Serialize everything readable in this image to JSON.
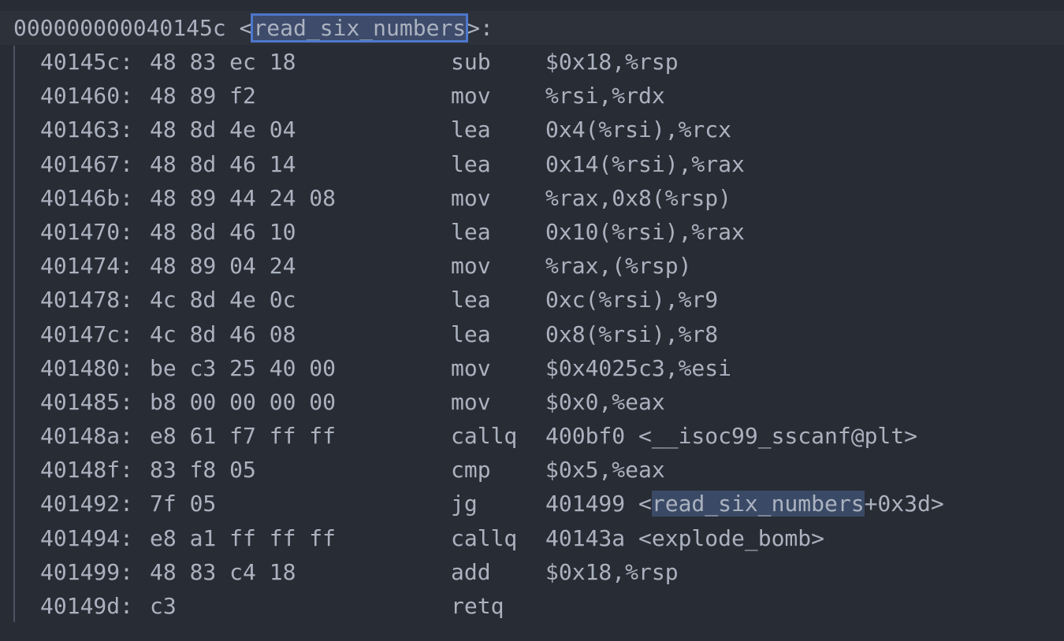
{
  "header": {
    "address": "000000000040145c",
    "open": " <",
    "function_name": "read_six_numbers",
    "close": ">:"
  },
  "highlight_colors": {
    "selection": "#3e4b6b",
    "selection_border": "#4d78cc",
    "line_highlight": "#2c313a",
    "background": "#282c34",
    "text": "#abb2bf"
  },
  "instructions": [
    {
      "addr": "40145c:",
      "bytes": "48 83 ec 18",
      "mnem": "sub",
      "ops": "$0x18,%rsp"
    },
    {
      "addr": "401460:",
      "bytes": "48 89 f2",
      "mnem": "mov",
      "ops": "%rsi,%rdx"
    },
    {
      "addr": "401463:",
      "bytes": "48 8d 4e 04",
      "mnem": "lea",
      "ops": "0x4(%rsi),%rcx"
    },
    {
      "addr": "401467:",
      "bytes": "48 8d 46 14",
      "mnem": "lea",
      "ops": "0x14(%rsi),%rax"
    },
    {
      "addr": "40146b:",
      "bytes": "48 89 44 24 08",
      "mnem": "mov",
      "ops": "%rax,0x8(%rsp)"
    },
    {
      "addr": "401470:",
      "bytes": "48 8d 46 10",
      "mnem": "lea",
      "ops": "0x10(%rsi),%rax"
    },
    {
      "addr": "401474:",
      "bytes": "48 89 04 24",
      "mnem": "mov",
      "ops": "%rax,(%rsp)"
    },
    {
      "addr": "401478:",
      "bytes": "4c 8d 4e 0c",
      "mnem": "lea",
      "ops": "0xc(%rsi),%r9"
    },
    {
      "addr": "40147c:",
      "bytes": "4c 8d 46 08",
      "mnem": "lea",
      "ops": "0x8(%rsi),%r8"
    },
    {
      "addr": "401480:",
      "bytes": "be c3 25 40 00",
      "mnem": "mov",
      "ops": "$0x4025c3,%esi"
    },
    {
      "addr": "401485:",
      "bytes": "b8 00 00 00 00",
      "mnem": "mov",
      "ops": "$0x0,%eax"
    },
    {
      "addr": "40148a:",
      "bytes": "e8 61 f7 ff ff",
      "mnem": "callq",
      "ops": "400bf0 <__isoc99_sscanf@plt>"
    },
    {
      "addr": "40148f:",
      "bytes": "83 f8 05",
      "mnem": "cmp",
      "ops": "$0x5,%eax"
    },
    {
      "addr": "401492:",
      "bytes": "7f 05",
      "mnem": "jg",
      "ops_pre": "401499 <",
      "ops_hl": "read_six_numbers",
      "ops_post": "+0x3d>"
    },
    {
      "addr": "401494:",
      "bytes": "e8 a1 ff ff ff",
      "mnem": "callq",
      "ops": "40143a <explode_bomb>"
    },
    {
      "addr": "401499:",
      "bytes": "48 83 c4 18",
      "mnem": "add",
      "ops": "$0x18,%rsp"
    },
    {
      "addr": "40149d:",
      "bytes": "c3",
      "mnem": "retq",
      "ops": ""
    }
  ]
}
